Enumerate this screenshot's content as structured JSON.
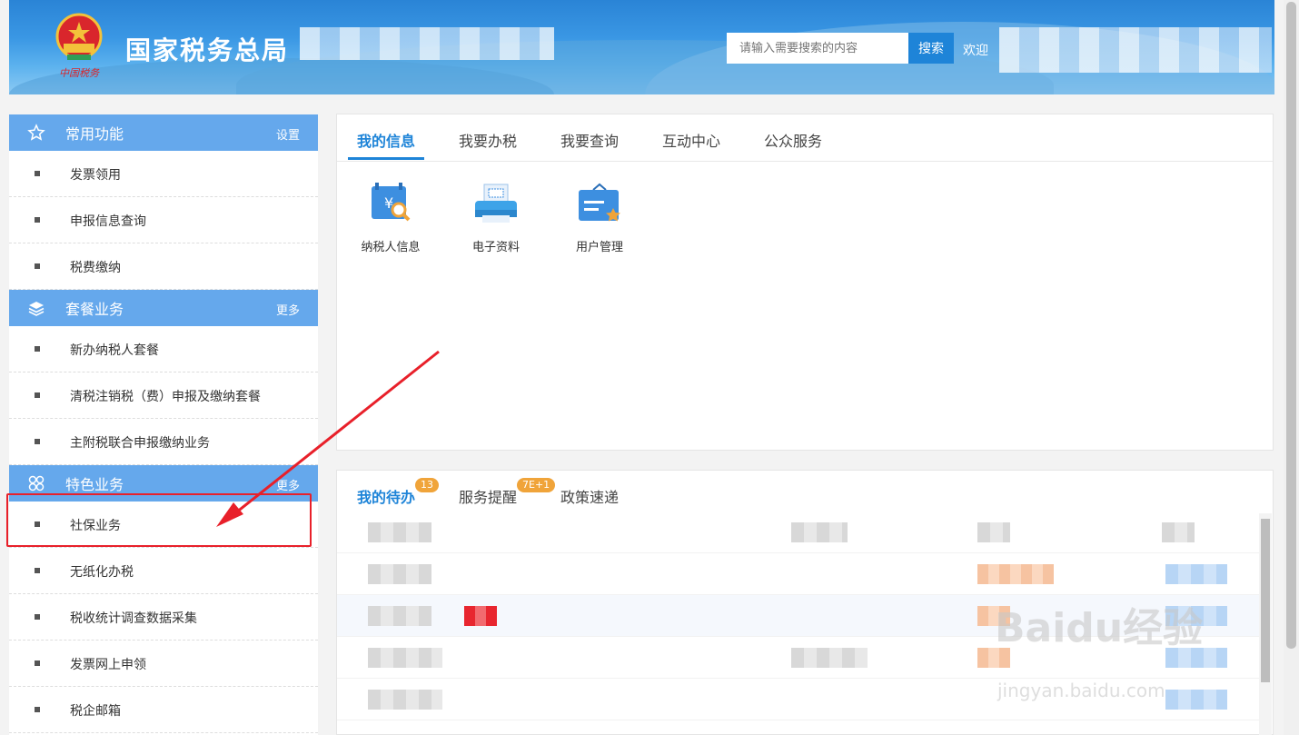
{
  "header": {
    "title": "国家税务总局",
    "emblem_text": "中国税务",
    "search_placeholder": "请输入需要搜索的内容",
    "search_button": "搜索",
    "welcome": "欢迎"
  },
  "sidebar": {
    "sections": [
      {
        "title": "常用功能",
        "action": "设置",
        "icon": "star-icon",
        "items": [
          "发票领用",
          "申报信息查询",
          "税费缴纳"
        ]
      },
      {
        "title": "套餐业务",
        "action": "更多",
        "icon": "layers-icon",
        "items": [
          "新办纳税人套餐",
          "清税注销税（费）申报及缴纳套餐",
          "主附税联合申报缴纳业务"
        ]
      },
      {
        "title": "特色业务",
        "action": "更多",
        "icon": "grid-icon",
        "items": [
          "社保业务",
          "无纸化办税",
          "税收统计调查数据采集",
          "发票网上申领",
          "税企邮箱"
        ]
      }
    ]
  },
  "main": {
    "tabs": [
      "我的信息",
      "我要办税",
      "我要查询",
      "互动中心",
      "公众服务"
    ],
    "active_tab": "我的信息",
    "apps": [
      "纳税人信息",
      "电子资料",
      "用户管理"
    ]
  },
  "tasks": {
    "tabs": [
      "我的待办",
      "服务提醒",
      "政策速递"
    ],
    "badges": [
      "13",
      "7E+1"
    ]
  },
  "watermark": {
    "brand": "Baidu经验",
    "url": "jingyan.baidu.com"
  },
  "colors": {
    "primary": "#1e84d8",
    "section_header": "#65a8ec",
    "badge": "#f0a43a",
    "annotation": "#e8202a"
  }
}
